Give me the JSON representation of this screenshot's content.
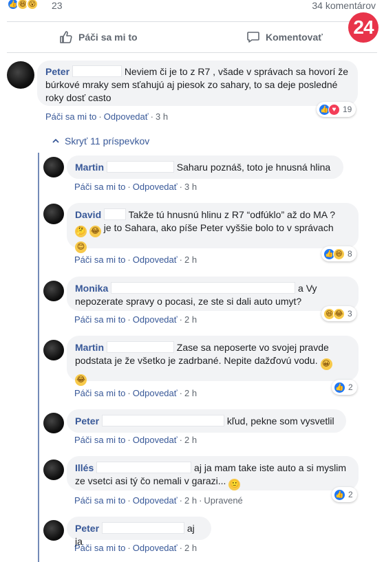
{
  "summary": {
    "reaction_count": "23",
    "comments_count": "34 komentárov",
    "reaction_icons": [
      "like-icon",
      "haha-icon",
      "wow-icon"
    ]
  },
  "actions": {
    "like_label": "Páči sa mi to",
    "comment_label": "Komentovať"
  },
  "logo": {
    "text": "24",
    "color": "#e8344a"
  },
  "hide_replies": "Skryť 11 príspevkov",
  "meta": {
    "like": "Páči sa mi to",
    "reply": "Odpovedať",
    "edited": "Upravené"
  },
  "comments": [
    {
      "name": "Peter",
      "text": "Neviem či je to z R7 , všade v správach sa hovorí že búrkové mraky sem sťahujú aj piesok zo sahary, to sa deje posledné roky dosť casto",
      "time": "3 h",
      "reactions": "19"
    },
    {
      "name": "Martin",
      "text": "Saharu poznáš, toto je hnusná hlina",
      "time": "3 h"
    },
    {
      "name": "David",
      "text_a": "Takže tú hnusnú hlinu z R7 “odfúklo” až do MA ?",
      "text_b": "je to Sahara, ako píše Peter vyššie bolo to v správach",
      "time": "2 h",
      "reactions": "8"
    },
    {
      "name": "Monika",
      "text_a": "a Vy",
      "text_b": "nepozerate spravy o pocasi, ze ste si dali auto umyt?",
      "time": "2 h",
      "reactions": "3"
    },
    {
      "name": "Martin",
      "text_a": "Zase sa neposerte vo svojej pravde",
      "text_b": "podstata je že všetko je zadrbané. Nepite dažďovú vodu.",
      "time": "2 h",
      "reactions": "2"
    },
    {
      "name": "Peter",
      "text": "kľud, pekne som vysvetlil",
      "time": "2 h"
    },
    {
      "name": "Illés",
      "text_a": "aj ja mam take iste auto a si myslim",
      "text_b": "ze vsetci asi tý čo nemali v garazi...",
      "time": "2 h",
      "reactions": "2"
    },
    {
      "name": "Peter",
      "text": "aj ja",
      "time": "2 h"
    }
  ],
  "colors": {
    "link": "#385898",
    "bubble": "#f2f3f5",
    "meta": "#606770",
    "like": "#2078f4"
  }
}
